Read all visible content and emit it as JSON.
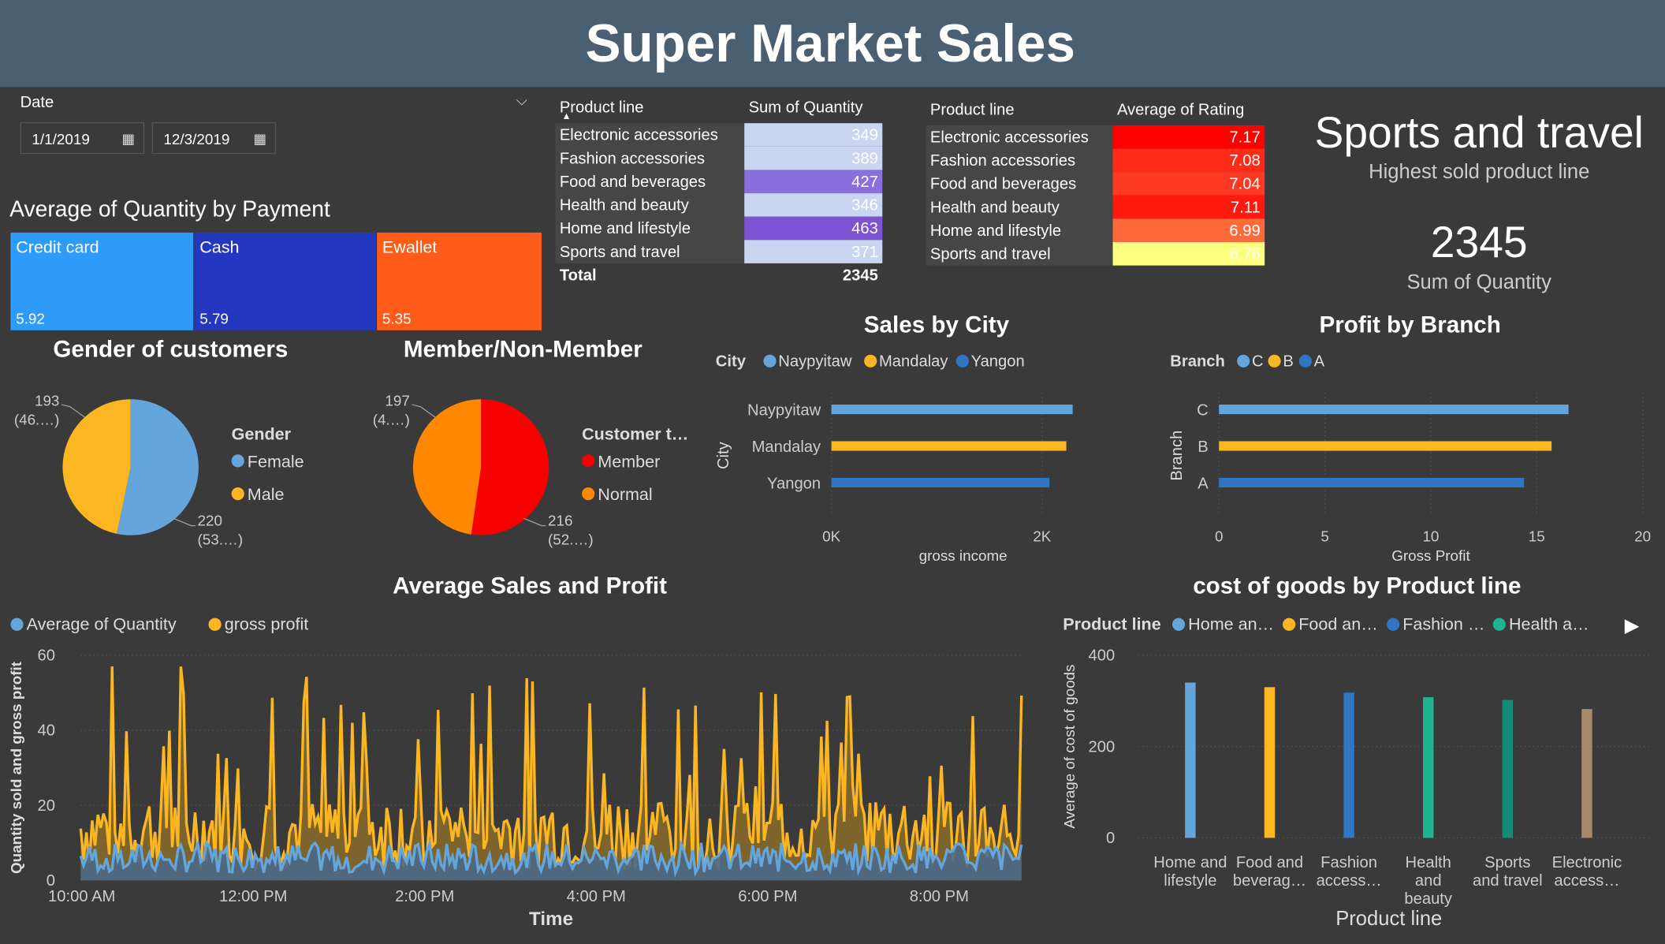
{
  "header": {
    "title": "Super Market Sales"
  },
  "date_filter": {
    "label": "Date",
    "start": "1/1/2019",
    "end": "12/3/2019"
  },
  "payment": {
    "title": "Average of Quantity by Payment",
    "items": [
      {
        "label": "Credit card",
        "value": "5.92",
        "color": "#2e9bf9"
      },
      {
        "label": "Cash",
        "value": "5.79",
        "color": "#2437c1"
      },
      {
        "label": "Ewallet",
        "value": "5.35",
        "color": "#ff5c1a"
      }
    ]
  },
  "quantity_table": {
    "headers": [
      "Product line",
      "Sum of Quantity"
    ],
    "rows": [
      {
        "name": "Electronic accessories",
        "value": "349",
        "color": "#c9d5f1"
      },
      {
        "name": "Fashion accessories",
        "value": "389",
        "color": "#c9d5f1"
      },
      {
        "name": "Food and beverages",
        "value": "427",
        "color": "#8b6fdc"
      },
      {
        "name": "Health and beauty",
        "value": "346",
        "color": "#c9d5f1"
      },
      {
        "name": "Home and lifestyle",
        "value": "463",
        "color": "#7d53d4"
      },
      {
        "name": "Sports and travel",
        "value": "371",
        "color": "#c9d5f1"
      }
    ],
    "total_label": "Total",
    "total_value": "2345"
  },
  "rating_table": {
    "headers": [
      "Product line",
      "Average of Rating"
    ],
    "rows": [
      {
        "name": "Electronic accessories",
        "value": "7.17",
        "color": "#ff0000"
      },
      {
        "name": "Fashion accessories",
        "value": "7.08",
        "color": "#ff2a18"
      },
      {
        "name": "Food and beverages",
        "value": "7.04",
        "color": "#ff3a22"
      },
      {
        "name": "Health and beauty",
        "value": "7.11",
        "color": "#ff1a10"
      },
      {
        "name": "Home and lifestyle",
        "value": "6.99",
        "color": "#ff6a3a"
      },
      {
        "name": "Sports and travel",
        "value": "6.76",
        "color": "#ffff80"
      }
    ]
  },
  "kpi": {
    "top_value": "Sports and travel",
    "top_label": "Highest sold product line",
    "sum_value": "2345",
    "sum_label": "Sum of Quantity"
  },
  "gender": {
    "title": "Gender of customers",
    "legend_title": "Gender",
    "items": [
      {
        "label": "Female",
        "value": 220,
        "lbl1": "220",
        "lbl2": "(53.…)",
        "color": "#64a6dc"
      },
      {
        "label": "Male",
        "value": 193,
        "lbl1": "193",
        "lbl2": "(46.…)",
        "color": "#fcb622"
      }
    ]
  },
  "member": {
    "title": "Member/Non-Member",
    "legend_title": "Customer t…",
    "items": [
      {
        "label": "Member",
        "value": 216,
        "lbl1": "216",
        "lbl2": "(52.…)",
        "color": "#f70000"
      },
      {
        "label": "Normal",
        "value": 197,
        "lbl1": "197",
        "lbl2": "(4.…)",
        "color": "#ff8800"
      }
    ]
  },
  "chart_data": [
    {
      "type": "bar",
      "orientation": "horizontal",
      "title": "Sales by City",
      "legend_title": "City",
      "categories": [
        "Naypyitaw",
        "Mandalay",
        "Yangon"
      ],
      "values": [
        2290,
        2230,
        2070
      ],
      "colors": [
        "#64a6dc",
        "#fcb622",
        "#2f76c4"
      ],
      "xlabel": "gross income",
      "ylabel": "City",
      "xticks": [
        "0K",
        "2K"
      ],
      "xlim": [
        0,
        2500
      ]
    },
    {
      "type": "bar",
      "orientation": "horizontal",
      "title": "Profit by Branch",
      "legend_title": "Branch",
      "legend": [
        "C",
        "B",
        "A"
      ],
      "categories": [
        "C",
        "B",
        "A"
      ],
      "values": [
        16.5,
        15.7,
        14.4
      ],
      "colors": [
        "#64a6dc",
        "#fcb622",
        "#2f76c4"
      ],
      "xlabel": "Gross Profit",
      "ylabel": "Branch",
      "xticks": [
        "0",
        "5",
        "10",
        "15",
        "20"
      ],
      "xlim": [
        0,
        20
      ]
    },
    {
      "type": "area",
      "title": "Average Sales and Profit",
      "series": [
        {
          "name": "Average of Quantity",
          "color": "#64a6dc"
        },
        {
          "name": "gross profit",
          "color": "#fcb622"
        }
      ],
      "xlabel": "Time",
      "ylabel": "Quantity sold and gross profit",
      "xticks": [
        "10:00 AM",
        "12:00 PM",
        "2:00 PM",
        "4:00 PM",
        "6:00 PM",
        "8:00 PM"
      ],
      "yticks": [
        "0",
        "20",
        "40",
        "60"
      ],
      "ylim": [
        0,
        60
      ]
    },
    {
      "type": "bar",
      "title": "cost of goods by Product line",
      "legend_title": "Product line",
      "legend": [
        "Home an…",
        "Food an…",
        "Fashion …",
        "Health a…"
      ],
      "categories": [
        [
          "Home and",
          "lifestyle"
        ],
        [
          "Food and",
          "beverag…"
        ],
        [
          "Fashion",
          "access…"
        ],
        [
          "Health",
          "and",
          "beauty"
        ],
        [
          "Sports",
          "and travel"
        ],
        [
          "Electronic",
          "access…"
        ]
      ],
      "values": [
        340,
        330,
        318,
        308,
        302,
        282
      ],
      "colors": [
        "#64a6dc",
        "#fcb622",
        "#2f76c4",
        "#1fb38f",
        "#158a76",
        "#a58b69"
      ],
      "xlabel": "Product line",
      "ylabel": "Average of cost of goods",
      "yticks": [
        "0",
        "200",
        "400"
      ],
      "ylim": [
        0,
        400
      ]
    }
  ]
}
